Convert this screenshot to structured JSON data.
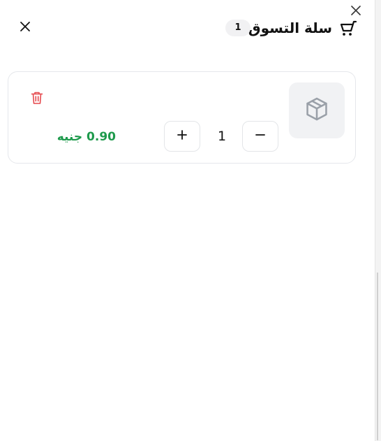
{
  "header": {
    "title": "سلة التسوق",
    "item_count": "1",
    "icons": {
      "cart": "shopping-cart-icon",
      "close": "close-icon",
      "overlay_close": "close-icon"
    }
  },
  "cart": {
    "items": [
      {
        "image_icon": "package-icon",
        "quantity": "1",
        "price_label": "0.90 جنيه",
        "delete_icon": "trash-icon",
        "decrement_icon": "minus-icon",
        "increment_icon": "plus-icon"
      }
    ]
  },
  "colors": {
    "price": "#1e9a4c",
    "delete": "#e5484d",
    "border": "#e5e7eb",
    "badge_bg": "#f1f1f3",
    "thumb_bg": "#f1f2f4",
    "thumb_icon": "#9aa0a8"
  }
}
